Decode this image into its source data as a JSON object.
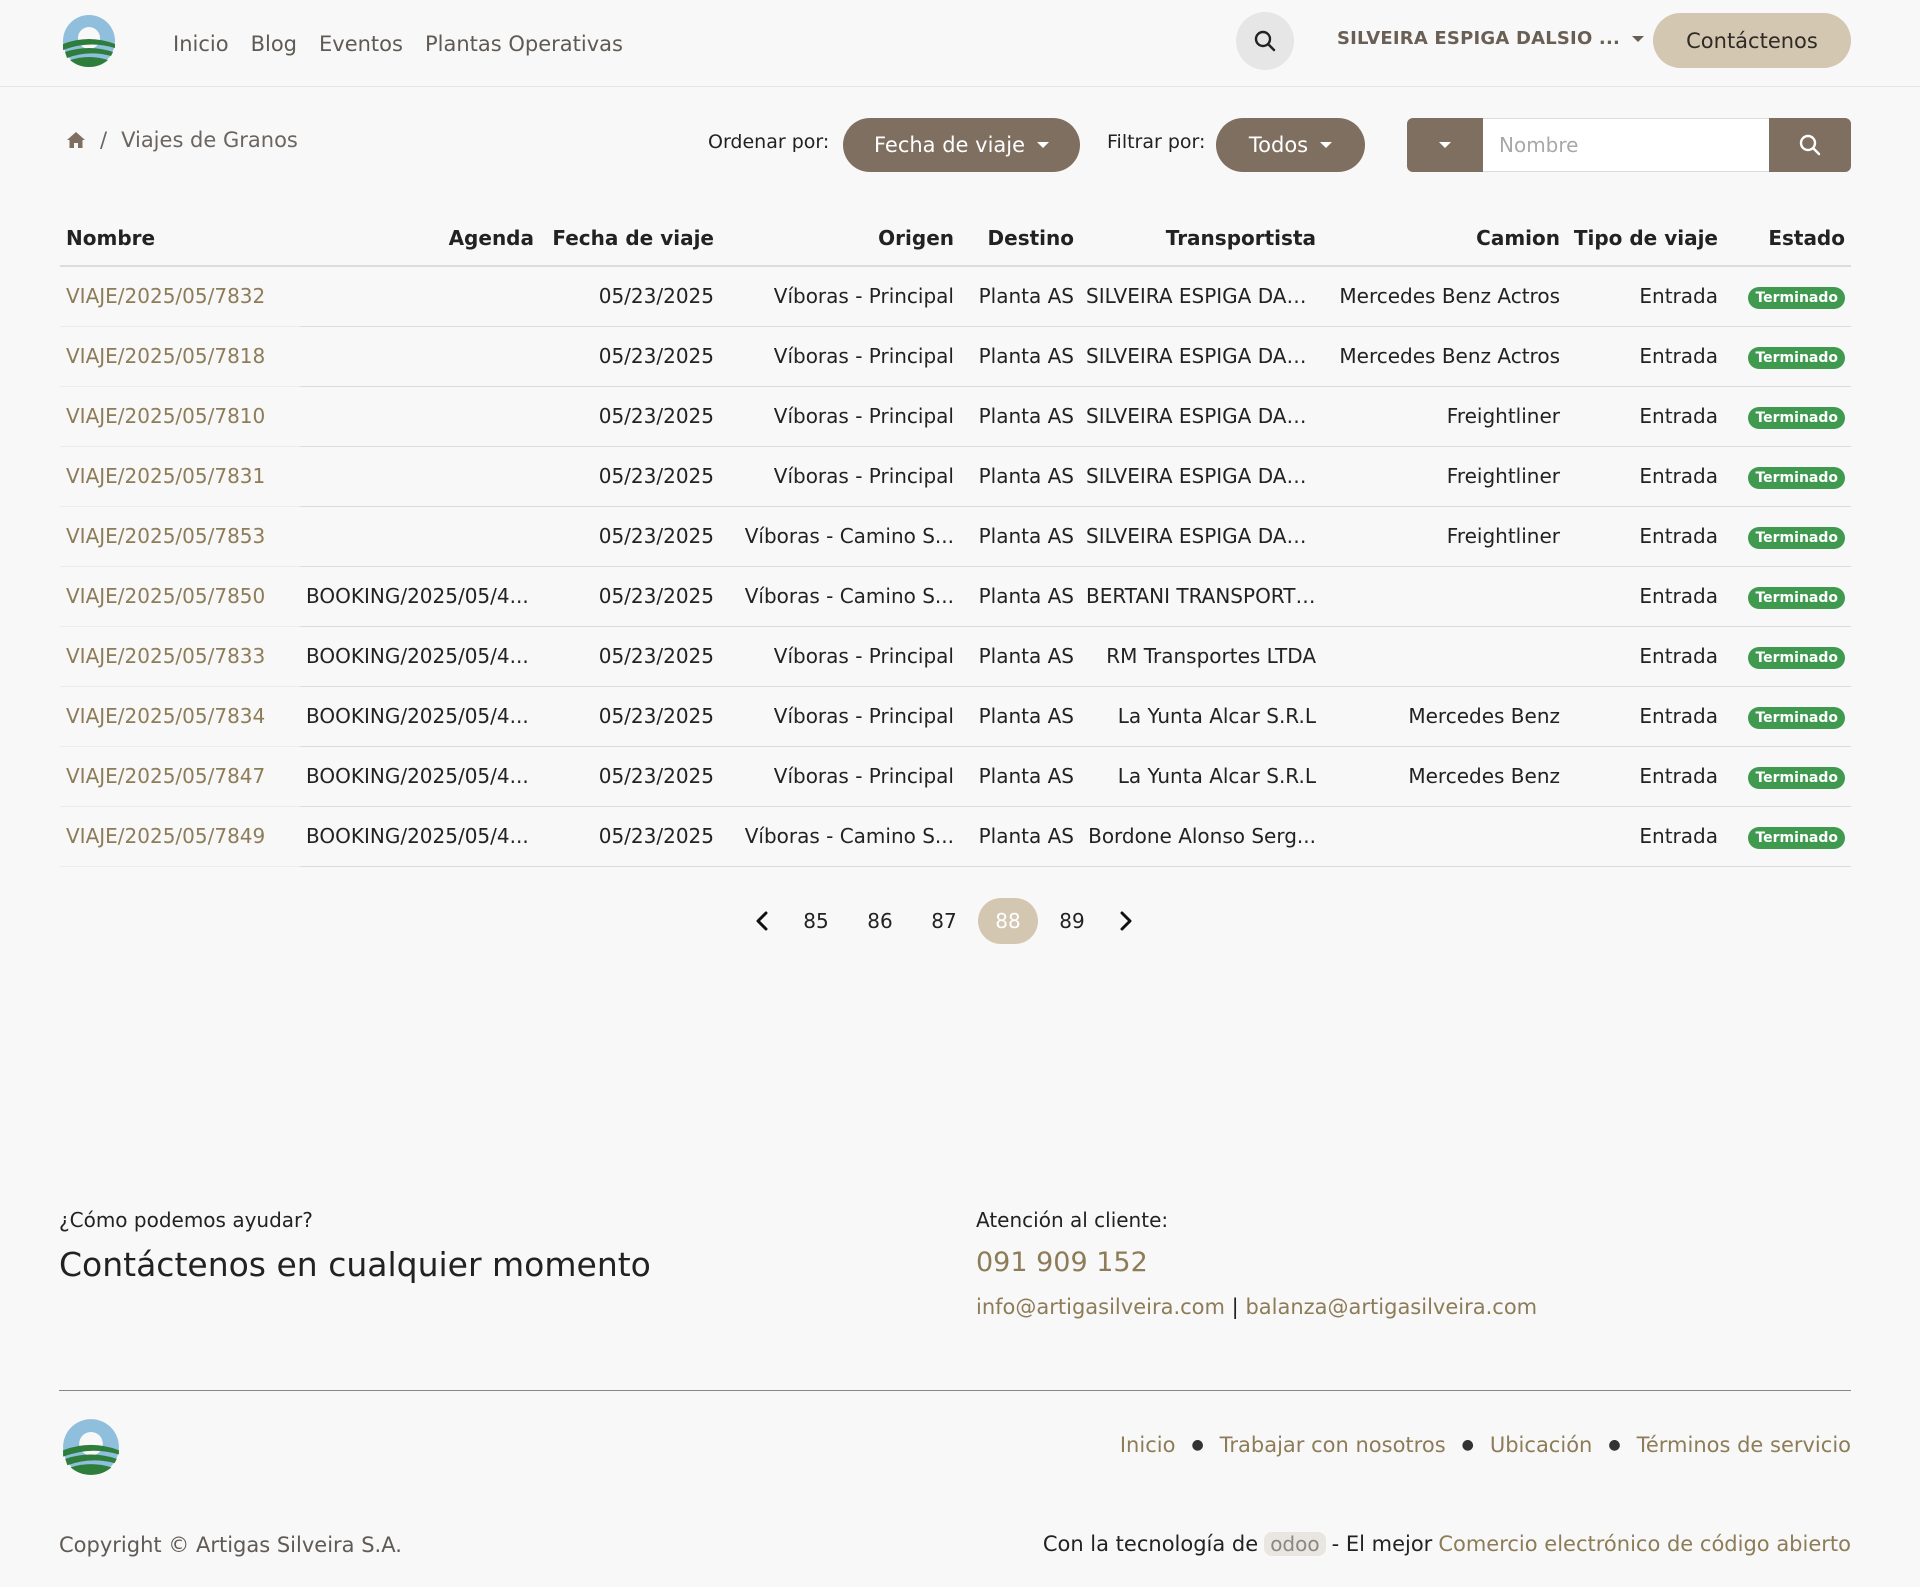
{
  "header": {
    "nav": [
      "Inicio",
      "Blog",
      "Eventos",
      "Plantas Operativas"
    ],
    "user_name": "SILVEIRA ESPIGA DALSIO ...",
    "contact_label": "Contáctenos"
  },
  "breadcrumb": {
    "separator": "/",
    "current": "Viajes de Granos"
  },
  "toolbar": {
    "sort_label": "Ordenar por:",
    "sort_value": "Fecha de viaje",
    "filter_label": "Filtrar por:",
    "filter_value": "Todos",
    "search_placeholder": "Nombre",
    "search_value": ""
  },
  "table": {
    "columns": [
      "Nombre",
      "Agenda",
      "Fecha de viaje",
      "Origen",
      "Destino",
      "Transportista",
      "Camion",
      "Tipo de viaje",
      "Estado"
    ],
    "rows": [
      {
        "nombre": "VIAJE/2025/05/7832",
        "agenda": "",
        "fecha": "05/23/2025",
        "origen": "Víboras - Principal",
        "destino": "Planta AS",
        "transportista": "SILVEIRA ESPIGA DALS...",
        "camion": "Mercedes Benz Actros",
        "tipo": "Entrada",
        "estado": "Terminado"
      },
      {
        "nombre": "VIAJE/2025/05/7818",
        "agenda": "",
        "fecha": "05/23/2025",
        "origen": "Víboras - Principal",
        "destino": "Planta AS",
        "transportista": "SILVEIRA ESPIGA DALS...",
        "camion": "Mercedes Benz Actros",
        "tipo": "Entrada",
        "estado": "Terminado"
      },
      {
        "nombre": "VIAJE/2025/05/7810",
        "agenda": "",
        "fecha": "05/23/2025",
        "origen": "Víboras - Principal",
        "destino": "Planta AS",
        "transportista": "SILVEIRA ESPIGA DALS...",
        "camion": "Freightliner",
        "tipo": "Entrada",
        "estado": "Terminado"
      },
      {
        "nombre": "VIAJE/2025/05/7831",
        "agenda": "",
        "fecha": "05/23/2025",
        "origen": "Víboras - Principal",
        "destino": "Planta AS",
        "transportista": "SILVEIRA ESPIGA DALS...",
        "camion": "Freightliner",
        "tipo": "Entrada",
        "estado": "Terminado"
      },
      {
        "nombre": "VIAJE/2025/05/7853",
        "agenda": "",
        "fecha": "05/23/2025",
        "origen": "Víboras - Camino S...",
        "destino": "Planta AS",
        "transportista": "SILVEIRA ESPIGA DALS...",
        "camion": "Freightliner",
        "tipo": "Entrada",
        "estado": "Terminado"
      },
      {
        "nombre": "VIAJE/2025/05/7850",
        "agenda": "BOOKING/2025/05/4...",
        "fecha": "05/23/2025",
        "origen": "Víboras - Camino S...",
        "destino": "Planta AS",
        "transportista": "BERTANI TRANSPORTE...",
        "camion": "",
        "tipo": "Entrada",
        "estado": "Terminado"
      },
      {
        "nombre": "VIAJE/2025/05/7833",
        "agenda": "BOOKING/2025/05/4...",
        "fecha": "05/23/2025",
        "origen": "Víboras - Principal",
        "destino": "Planta AS",
        "transportista": "RM Transportes LTDA",
        "camion": "",
        "tipo": "Entrada",
        "estado": "Terminado"
      },
      {
        "nombre": "VIAJE/2025/05/7834",
        "agenda": "BOOKING/2025/05/4...",
        "fecha": "05/23/2025",
        "origen": "Víboras - Principal",
        "destino": "Planta AS",
        "transportista": "La Yunta Alcar S.R.L",
        "camion": "Mercedes Benz",
        "tipo": "Entrada",
        "estado": "Terminado"
      },
      {
        "nombre": "VIAJE/2025/05/7847",
        "agenda": "BOOKING/2025/05/4...",
        "fecha": "05/23/2025",
        "origen": "Víboras - Principal",
        "destino": "Planta AS",
        "transportista": "La Yunta Alcar S.R.L",
        "camion": "Mercedes Benz",
        "tipo": "Entrada",
        "estado": "Terminado"
      },
      {
        "nombre": "VIAJE/2025/05/7849",
        "agenda": "BOOKING/2025/05/4...",
        "fecha": "05/23/2025",
        "origen": "Víboras - Camino S...",
        "destino": "Planta AS",
        "transportista": "Bordone Alonso Serg...",
        "camion": "",
        "tipo": "Entrada",
        "estado": "Terminado"
      }
    ]
  },
  "pagination": {
    "pages": [
      "85",
      "86",
      "87",
      "88",
      "89"
    ],
    "current": "88"
  },
  "footer": {
    "help_question": "¿Cómo podemos ayudar?",
    "help_heading": "Contáctenos en cualquier momento",
    "attention_label": "Atención al cliente:",
    "phone": "091 909 152",
    "email_1": "info@artigasilveira.com",
    "email_sep": "|",
    "email_2": "balanza@artigasilveira.com",
    "links": [
      "Inicio",
      "Trabajar con nosotros",
      "Ubicación",
      "Términos de servicio"
    ],
    "copyright": "Copyright © Artigas Silveira S.A.",
    "powered_prefix": "Con la tecnología de",
    "powered_brand": "odoo",
    "powered_middle": "- El mejor",
    "powered_link": "Comercio electrónico de código abierto"
  },
  "colors": {
    "accent_brown": "#7f6f60",
    "accent_beige": "#d3c7b1",
    "link_olive": "#8d7c57",
    "status_green": "#3f9a50"
  }
}
